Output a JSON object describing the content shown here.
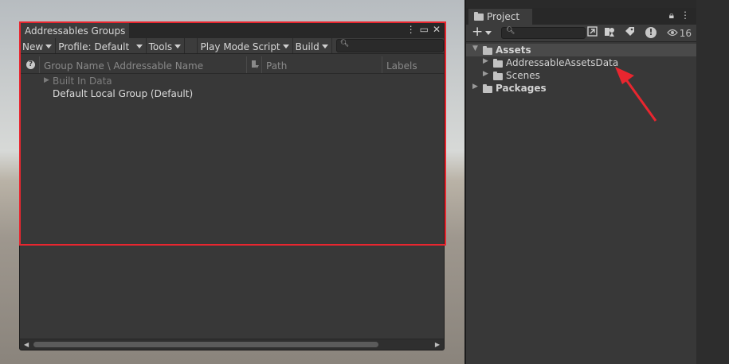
{
  "addressables": {
    "tab_title": "Addressables Groups",
    "toolbar": {
      "new_label": "New",
      "profile_label": "Profile: Default",
      "tools_label": "Tools",
      "playmode_label": "Play Mode Script",
      "build_label": "Build"
    },
    "columns": {
      "help": "?",
      "name": "Group Name \\ Addressable Name",
      "path": "Path",
      "labels": "Labels"
    },
    "rows": [
      {
        "label": "Built In Data"
      },
      {
        "label": "Default Local Group (Default)"
      }
    ]
  },
  "project": {
    "tab_title": "Project",
    "visible_count": "16",
    "tree": {
      "assets": "Assets",
      "addressable_data": "AddressableAssetsData",
      "scenes": "Scenes",
      "packages": "Packages"
    }
  },
  "colors": {
    "highlight": "#e8262f",
    "annotation_arrow": "#e8262f",
    "window_bg": "#383838"
  },
  "icons": [
    "help-icon",
    "more-icon",
    "maximize-icon",
    "close-icon",
    "search-icon",
    "lock-icon",
    "menu-icon",
    "plus-icon",
    "folder-icon",
    "label-icon",
    "warning-icon",
    "eye-icon"
  ]
}
